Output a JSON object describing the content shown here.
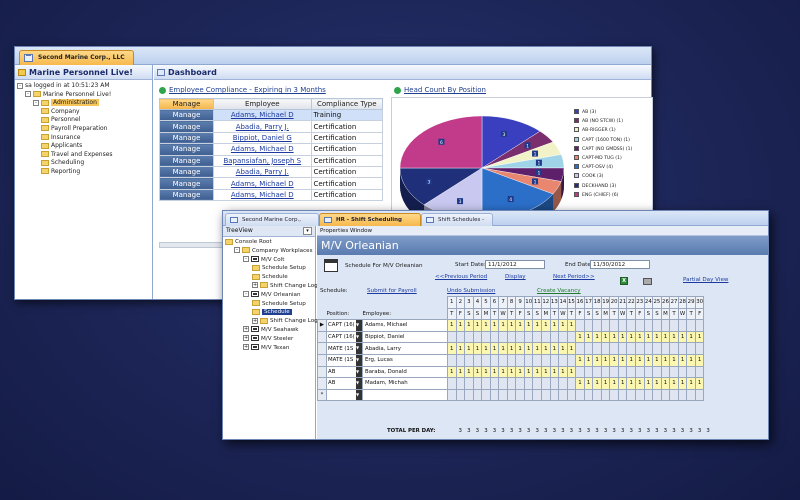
{
  "win1": {
    "tab_label": "Second Marine Corp., LLC",
    "left_header": "Marine Personnel Live!",
    "tree": [
      {
        "label": "sa logged in at 10:51:23 AM",
        "indent": 0,
        "kind": "info"
      },
      {
        "label": "Marine Personnel Live!",
        "indent": 1,
        "kind": "folder-open"
      },
      {
        "label": "Administration",
        "indent": 2,
        "kind": "folder-selected"
      },
      {
        "label": "Company",
        "indent": 3,
        "kind": "folder"
      },
      {
        "label": "Personnel",
        "indent": 3,
        "kind": "folder"
      },
      {
        "label": "Payroll Preparation",
        "indent": 3,
        "kind": "folder"
      },
      {
        "label": "Insurance",
        "indent": 3,
        "kind": "folder"
      },
      {
        "label": "Applicants",
        "indent": 3,
        "kind": "folder"
      },
      {
        "label": "Travel and Expenses",
        "indent": 3,
        "kind": "folder"
      },
      {
        "label": "Scheduling",
        "indent": 3,
        "kind": "folder"
      },
      {
        "label": "Reporting",
        "indent": 3,
        "kind": "folder"
      }
    ],
    "dashboard_title": "Dashboard",
    "compliance_title": "Employee Compliance - Expiring in 3 Months",
    "compliance_columns": [
      "Manage",
      "Employee",
      "Compliance Type"
    ],
    "compliance_rows": [
      {
        "manage": "Manage",
        "employee": "Adams, Michael D",
        "type": "Training",
        "hi": true
      },
      {
        "manage": "Manage",
        "employee": "Abadia, Parry J.",
        "type": "Certification",
        "hi": false
      },
      {
        "manage": "Manage",
        "employee": "Bippiot, Daniel G",
        "type": "Certification",
        "hi": false
      },
      {
        "manage": "Manage",
        "employee": "Adams, Michael D",
        "type": "Certification",
        "hi": false
      },
      {
        "manage": "Manage",
        "employee": "Bapansiafan, Joseph S",
        "type": "Certification",
        "hi": false
      },
      {
        "manage": "Manage",
        "employee": "Abadia, Parry J.",
        "type": "Certification",
        "hi": false
      },
      {
        "manage": "Manage",
        "employee": "Adams, Michael D",
        "type": "Certification",
        "hi": false
      },
      {
        "manage": "Manage",
        "employee": "Adams, Michael D",
        "type": "Certification",
        "hi": false
      }
    ],
    "headcount_title": "Head Count By Position"
  },
  "chart_data": {
    "type": "pie",
    "title": "Head Count By Position",
    "categories": [
      "AB (3)",
      "AB (NO STCW) (1)",
      "AB-RIGGER (1)",
      "CAPT (1600 TON) (1)",
      "CAPT (NO GMDSS) (1)",
      "CAPT-MD TUG (1)",
      "CAPT-OSV (4)",
      "COOK (3)",
      "DECKHAND (3)",
      "ENG (CHIEF) (6)"
    ],
    "values": [
      3,
      1,
      1,
      1,
      1,
      1,
      4,
      3,
      3,
      6
    ],
    "colors": [
      "#3a3fbf",
      "#7b2e6e",
      "#f2f2c8",
      "#9ed3e8",
      "#5e1f6b",
      "#e8866f",
      "#2b6fc9",
      "#c8c8f0",
      "#1f2f7a",
      "#c23a8a"
    ],
    "legend": "right"
  },
  "win2": {
    "tabs": [
      {
        "label": "Second Marine Corp., LLC",
        "active": false
      },
      {
        "label": "HR - Shift Scheduling Console",
        "active": true
      },
      {
        "label": "Shift Schedules -",
        "active": false
      }
    ],
    "treeview_label": "TreeView",
    "tree": [
      {
        "label": "Console Root",
        "indent": 0,
        "kind": "folder",
        "pm": ""
      },
      {
        "label": "Company Workplaces",
        "indent": 1,
        "kind": "folder",
        "pm": "-"
      },
      {
        "label": "M/V Colt",
        "indent": 2,
        "kind": "boat",
        "pm": "-"
      },
      {
        "label": "Schedule Setup",
        "indent": 3,
        "kind": "folder",
        "pm": ""
      },
      {
        "label": "Schedule",
        "indent": 3,
        "kind": "folder",
        "pm": ""
      },
      {
        "label": "Shift Change Logs",
        "indent": 3,
        "kind": "folder",
        "pm": "+"
      },
      {
        "label": "M/V Orleanian",
        "indent": 2,
        "kind": "boat",
        "pm": "-"
      },
      {
        "label": "Schedule Setup",
        "indent": 3,
        "kind": "folder",
        "pm": ""
      },
      {
        "label": "Schedule",
        "indent": 3,
        "kind": "selected",
        "pm": ""
      },
      {
        "label": "Shift Change Logs",
        "indent": 3,
        "kind": "folder",
        "pm": "+"
      },
      {
        "label": "M/V Seahawk",
        "indent": 2,
        "kind": "boat",
        "pm": "+"
      },
      {
        "label": "M/V Steeler",
        "indent": 2,
        "kind": "boat",
        "pm": "+"
      },
      {
        "label": "M/V Texan",
        "indent": 2,
        "kind": "boat",
        "pm": "+"
      }
    ],
    "properties_label": "Properties Window",
    "vessel_title": "M/V Orleanian",
    "schedule_for": "Schedule For M/V Orleanian",
    "start_label": "Start Date:",
    "start_value": "11/1/2012",
    "end_label": "End Date:",
    "end_value": "11/30/2012",
    "prev_link": "<<Previous Period",
    "display_link": "Display",
    "next_link": "Next Period>>",
    "partial_link": "Partial Day View",
    "schedule_label": "Schedule:",
    "submit_link": "Submit for Payroll",
    "undo_link": "Undo Submission",
    "vacancy_link": "Create Vacancy",
    "position_header": "Position:",
    "employee_header": "Employee:",
    "day_numbers": [
      "1",
      "2",
      "3",
      "4",
      "5",
      "6",
      "7",
      "8",
      "9",
      "10",
      "11",
      "12",
      "13",
      "14",
      "15",
      "16",
      "17",
      "18",
      "19",
      "20",
      "21",
      "22",
      "23",
      "24",
      "25",
      "26",
      "27",
      "28",
      "29",
      "30"
    ],
    "day_letters": [
      "T",
      "F",
      "S",
      "S",
      "M",
      "T",
      "W",
      "T",
      "F",
      "S",
      "S",
      "M",
      "T",
      "W",
      "T",
      "F",
      "S",
      "S",
      "M",
      "T",
      "W",
      "T",
      "F",
      "S",
      "S",
      "M",
      "T",
      "W",
      "T",
      "F"
    ],
    "rows": [
      {
        "position": "CAPT (16(",
        "employee": "Adams, Michael",
        "marker": "▶",
        "cells": [
          1,
          1,
          1,
          1,
          1,
          1,
          1,
          1,
          1,
          1,
          1,
          1,
          1,
          1,
          1,
          0,
          0,
          0,
          0,
          0,
          0,
          0,
          0,
          0,
          0,
          0,
          0,
          0,
          0,
          0
        ]
      },
      {
        "position": "CAPT (16(",
        "employee": "Bippiot, Daniel",
        "marker": "",
        "cells": [
          0,
          0,
          0,
          0,
          0,
          0,
          0,
          0,
          0,
          0,
          0,
          0,
          0,
          0,
          0,
          1,
          1,
          1,
          1,
          1,
          1,
          1,
          1,
          1,
          1,
          1,
          1,
          1,
          1,
          1
        ]
      },
      {
        "position": "MATE (1S",
        "employee": "Abadia, Larry",
        "marker": "",
        "cells": [
          1,
          1,
          1,
          1,
          1,
          1,
          1,
          1,
          1,
          1,
          1,
          1,
          1,
          1,
          1,
          0,
          0,
          0,
          0,
          0,
          0,
          0,
          0,
          0,
          0,
          0,
          0,
          0,
          0,
          0
        ]
      },
      {
        "position": "MATE (1S",
        "employee": "Erg, Lucas",
        "marker": "",
        "cells": [
          0,
          0,
          0,
          0,
          0,
          0,
          0,
          0,
          0,
          0,
          0,
          0,
          0,
          0,
          0,
          1,
          1,
          1,
          1,
          1,
          1,
          1,
          1,
          1,
          1,
          1,
          1,
          1,
          1,
          1
        ]
      },
      {
        "position": "AB",
        "employee": "Baraba, Donald",
        "marker": "",
        "cells": [
          1,
          1,
          1,
          1,
          1,
          1,
          1,
          1,
          1,
          1,
          1,
          1,
          1,
          1,
          1,
          0,
          0,
          0,
          0,
          0,
          0,
          0,
          0,
          0,
          0,
          0,
          0,
          0,
          0,
          0
        ]
      },
      {
        "position": "AB",
        "employee": "Madam, Michah",
        "marker": "",
        "cells": [
          0,
          0,
          0,
          0,
          0,
          0,
          0,
          0,
          0,
          0,
          0,
          0,
          0,
          0,
          0,
          1,
          1,
          1,
          1,
          1,
          1,
          1,
          1,
          1,
          1,
          1,
          1,
          1,
          1,
          1
        ]
      },
      {
        "position": "",
        "employee": "",
        "marker": "*",
        "cells": [
          0,
          0,
          0,
          0,
          0,
          0,
          0,
          0,
          0,
          0,
          0,
          0,
          0,
          0,
          0,
          0,
          0,
          0,
          0,
          0,
          0,
          0,
          0,
          0,
          0,
          0,
          0,
          0,
          0,
          0
        ]
      }
    ],
    "total_label": "TOTAL PER DAY:",
    "totals": [
      3,
      3,
      3,
      3,
      3,
      3,
      3,
      3,
      3,
      3,
      3,
      3,
      3,
      3,
      3,
      3,
      3,
      3,
      3,
      3,
      3,
      3,
      3,
      3,
      3,
      3,
      3,
      3,
      3,
      3
    ]
  }
}
